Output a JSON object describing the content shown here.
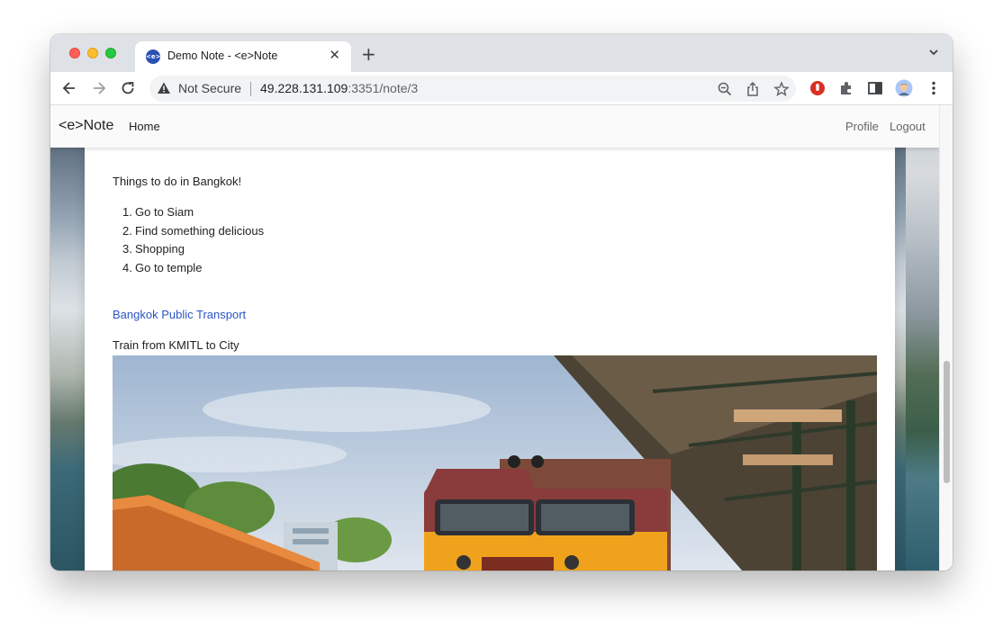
{
  "browser": {
    "tab_title": "Demo Note - <e>Note",
    "favicon_text": "<e>",
    "close_glyph": "✕",
    "new_tab_glyph": "+",
    "security_label": "Not Secure",
    "url_host": "49.228.131.109",
    "url_rest": ":3351/note/3"
  },
  "navbar": {
    "brand": "<e>Note",
    "home": "Home",
    "profile": "Profile",
    "logout": "Logout"
  },
  "note": {
    "intro": "Things to do in Bangkok!",
    "items": [
      {
        "num": "1.",
        "text": "Go to Siam"
      },
      {
        "num": "2.",
        "text": "Find something delicious"
      },
      {
        "num": "3.",
        "text": "Shopping"
      },
      {
        "num": "4.",
        "text": "Go to temple"
      }
    ],
    "link": "Bangkok Public Transport",
    "caption": "Train from KMITL to City"
  },
  "colors": {
    "link": "#2c55c4",
    "favicon": "#2a4fb5",
    "train_orange": "#f0a21d",
    "train_maroon": "#8a3b3b"
  }
}
